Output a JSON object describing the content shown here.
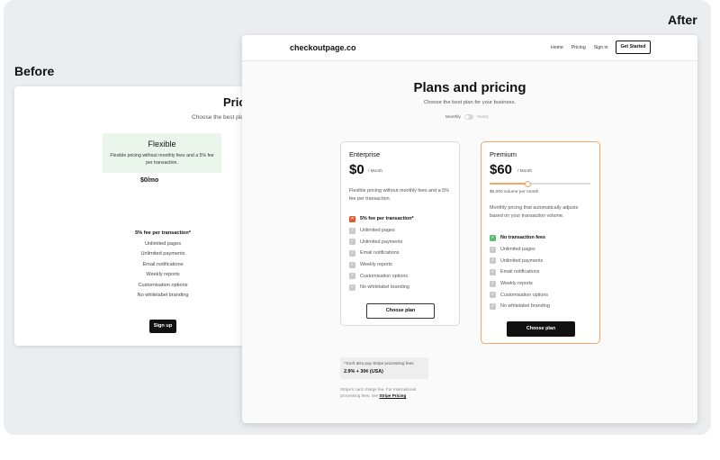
{
  "labels": {
    "before": "Before",
    "after": "After"
  },
  "before": {
    "title": "Pric",
    "subtitle": "Choose the best plan",
    "plan": {
      "name": "Flexible",
      "description": "Flexible pricing without monthly fees and a 5% fee per transaction.",
      "price": "$0/mo"
    },
    "features": [
      "5% fee per transaction*",
      "Unlimited pages",
      "Unlimited payments",
      "Email notifications",
      "Weekly reports",
      "Customisation options",
      "No whitelabel branding"
    ],
    "signup_label": "Sign up"
  },
  "after": {
    "nav": {
      "logo": "checkoutpage.co",
      "links": [
        "Home",
        "Pricing",
        "Sign in"
      ],
      "cta": "Get Started"
    },
    "title": "Plans and pricing",
    "subtitle": "Choose the best plan for your business.",
    "billing": {
      "monthly": "Monthly",
      "yearly": "Yearly"
    },
    "plans": [
      {
        "name": "Enterprise",
        "price": "$0",
        "unit": "/ Month",
        "description": "Flexible pricing without monthly fees and a 5% fee per transaction.",
        "features": [
          "5% fee per transaction*",
          "Unlimited pages",
          "Unlimited payments",
          "Email notifications",
          "Weekly reports",
          "Customisation options",
          "No whitelabel branding"
        ],
        "button": "Choose plan"
      },
      {
        "name": "Premium",
        "price": "$60",
        "unit": "/ Month",
        "slider_caption": "$5,000 volume per month",
        "slider_level": 0.38,
        "description": "Monthly pricing that automatically adjusts based on your transaction volume.",
        "features": [
          "No transaction fees",
          "Unlimited pages",
          "Unlimited payments",
          "Email notifications",
          "Weekly reports",
          "Customisation options",
          "No whitelabel branding"
        ],
        "button": "Choose plan"
      }
    ],
    "note": {
      "line1": "*You'll also pay Stripe processing fees",
      "line2": "2.9% + 30¢ (USA)"
    },
    "footnote": {
      "text": "Stripe's card charge fee. For international processing fees, see",
      "link": "Stripe Pricing"
    }
  },
  "icons": {
    "check": "check-icon",
    "cross": "cross-icon",
    "cursor": "hand-cursor-icon"
  },
  "colors": {
    "accent": "#f5a46b",
    "success": "#5bc073",
    "danger": "#e0592a",
    "before_plan_bg": "#eaf6ec"
  }
}
